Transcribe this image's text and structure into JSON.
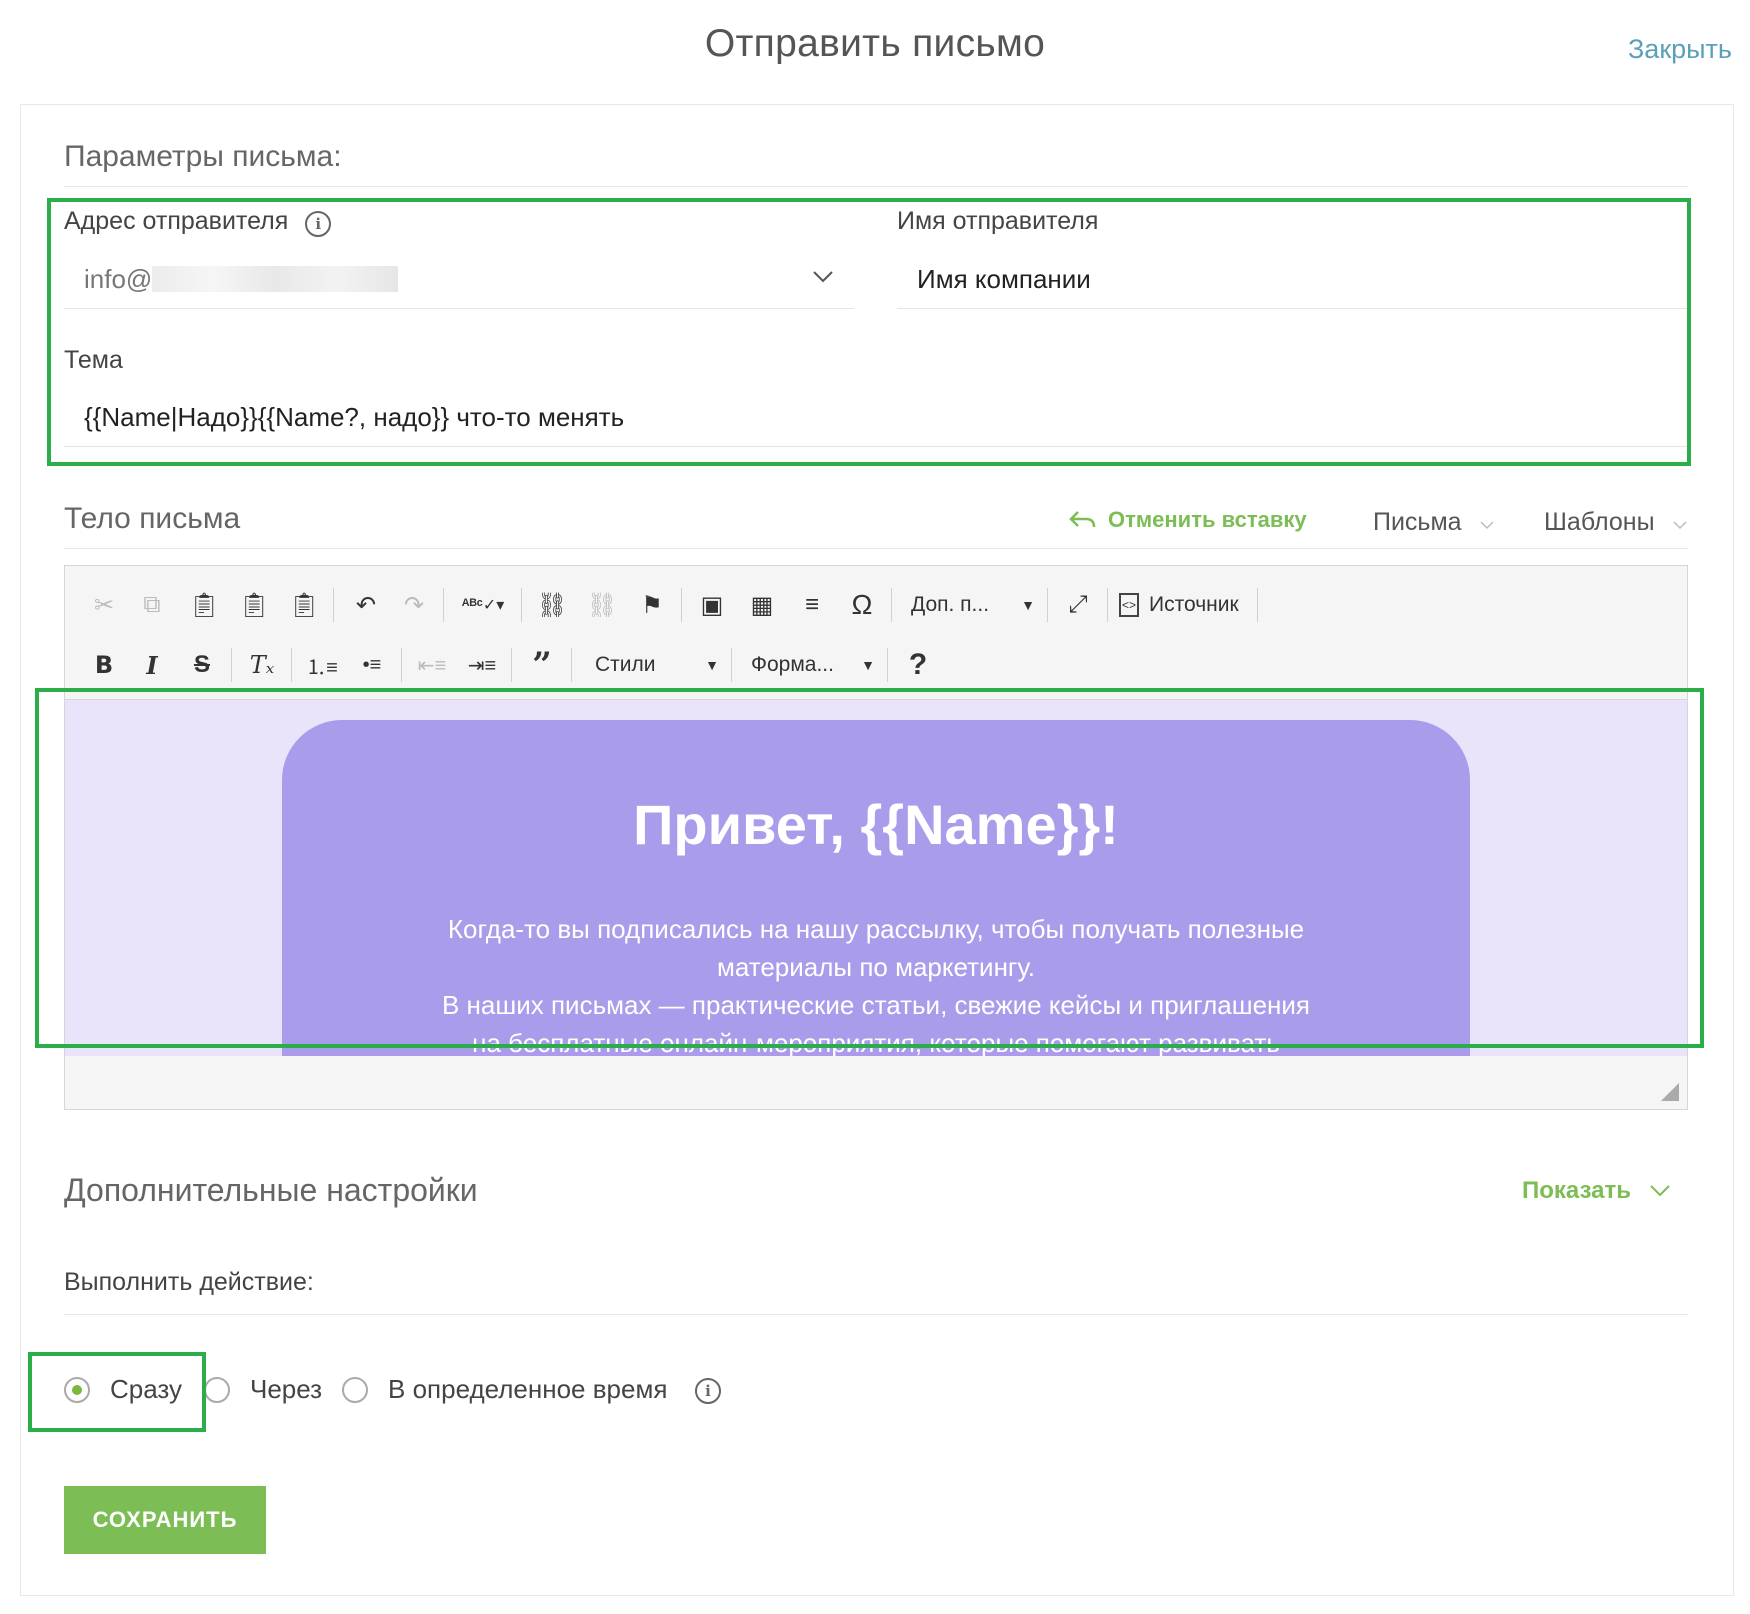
{
  "header": {
    "title": "Отправить письмо",
    "close": "Закрыть"
  },
  "params": {
    "heading": "Параметры письма:",
    "sender_address_label": "Адрес отправителя",
    "sender_address_value": "info@",
    "sender_name_label": "Имя отправителя",
    "sender_name_value": "Имя компании",
    "subject_label": "Тема",
    "subject_value": "{{Name|Надо}}{{Name?, надо}} что-то менять"
  },
  "body": {
    "heading": "Тело письма",
    "undo_paste": "Отменить вставку",
    "letters": "Письма",
    "templates": "Шаблоны"
  },
  "toolbar": {
    "more_combo": "Доп. п...",
    "source": "Источник",
    "styles_combo": "Стили",
    "format_combo": "Форма...",
    "help": "?"
  },
  "email": {
    "heading": "Привет, {{Name}}!",
    "line1": "Когда-то вы подписались на нашу рассылку, чтобы получать полезные",
    "line2": "материалы по маркетингу.",
    "line3": "В наших письмах — практические статьи, свежие кейсы и приглашения",
    "line4": "на бесплатные онлайн-мероприятия, которые помогают развивать"
  },
  "extra": {
    "heading": "Дополнительные настройки",
    "show": "Показать"
  },
  "action": {
    "label": "Выполнить действие:",
    "opt_now": "Сразу",
    "opt_after": "Через",
    "opt_time": "В определенное время",
    "selected": "Сразу"
  },
  "save": "СОХРАНИТЬ",
  "colors": {
    "accent_green": "#7cbd55",
    "highlight_box": "#2bae4a",
    "email_purple": "#a99deb",
    "link_blue": "#5aa0b8"
  }
}
